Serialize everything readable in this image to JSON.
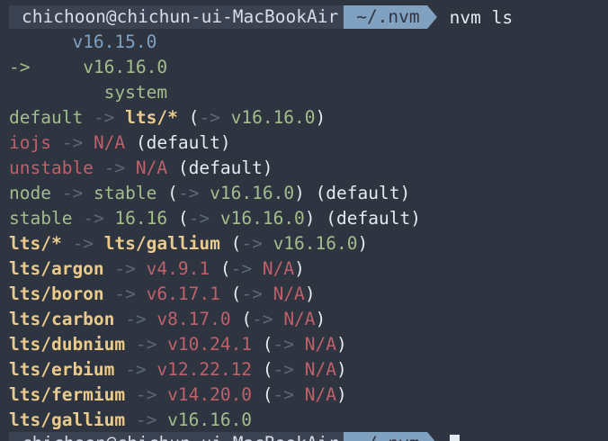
{
  "prompt": {
    "user_host": "chichoon@chichun-ui-MacBookAir",
    "directory": "~/.nvm",
    "command": "nvm ls"
  },
  "installed": [
    {
      "marker": "",
      "version": "v16.15.0"
    },
    {
      "marker": "->",
      "version": "v16.16.0"
    },
    {
      "marker": "",
      "version": "system"
    }
  ],
  "aliases": [
    {
      "name": "default",
      "target": "lts/*",
      "resolved": "v16.16.0",
      "suffix": ""
    },
    {
      "name": "iojs",
      "target": "N/A",
      "resolved": "",
      "suffix": "(default)"
    },
    {
      "name": "unstable",
      "target": "N/A",
      "resolved": "",
      "suffix": "(default)"
    },
    {
      "name": "node",
      "target": "stable",
      "resolved": "v16.16.0",
      "suffix": "(default)"
    },
    {
      "name": "stable",
      "target": "16.16",
      "resolved": "v16.16.0",
      "suffix": "(default)"
    },
    {
      "name": "lts/*",
      "target": "lts/gallium",
      "resolved": "v16.16.0",
      "suffix": ""
    }
  ],
  "lts": [
    {
      "name": "lts/argon",
      "version": "v4.9.1",
      "resolved": "N/A"
    },
    {
      "name": "lts/boron",
      "version": "v6.17.1",
      "resolved": "N/A"
    },
    {
      "name": "lts/carbon",
      "version": "v8.17.0",
      "resolved": "N/A"
    },
    {
      "name": "lts/dubnium",
      "version": "v10.24.1",
      "resolved": "N/A"
    },
    {
      "name": "lts/erbium",
      "version": "v12.22.12",
      "resolved": "N/A"
    },
    {
      "name": "lts/fermium",
      "version": "v14.20.0",
      "resolved": "N/A"
    },
    {
      "name": "lts/gallium",
      "version": "v16.16.0",
      "resolved": ""
    }
  ],
  "symbols": {
    "arrow": "->",
    "open_paren": "(",
    "close_paren": ")",
    "default_suffix": "(default)"
  },
  "colors": {
    "background": "#2e3440",
    "host_segment": "#3b4252",
    "dir_segment": "#81a1c1",
    "installed_version": "#81a1c1",
    "alias_name": "#a3be8c",
    "na": "#bf616a",
    "lts_name": "#ebcb8b"
  }
}
